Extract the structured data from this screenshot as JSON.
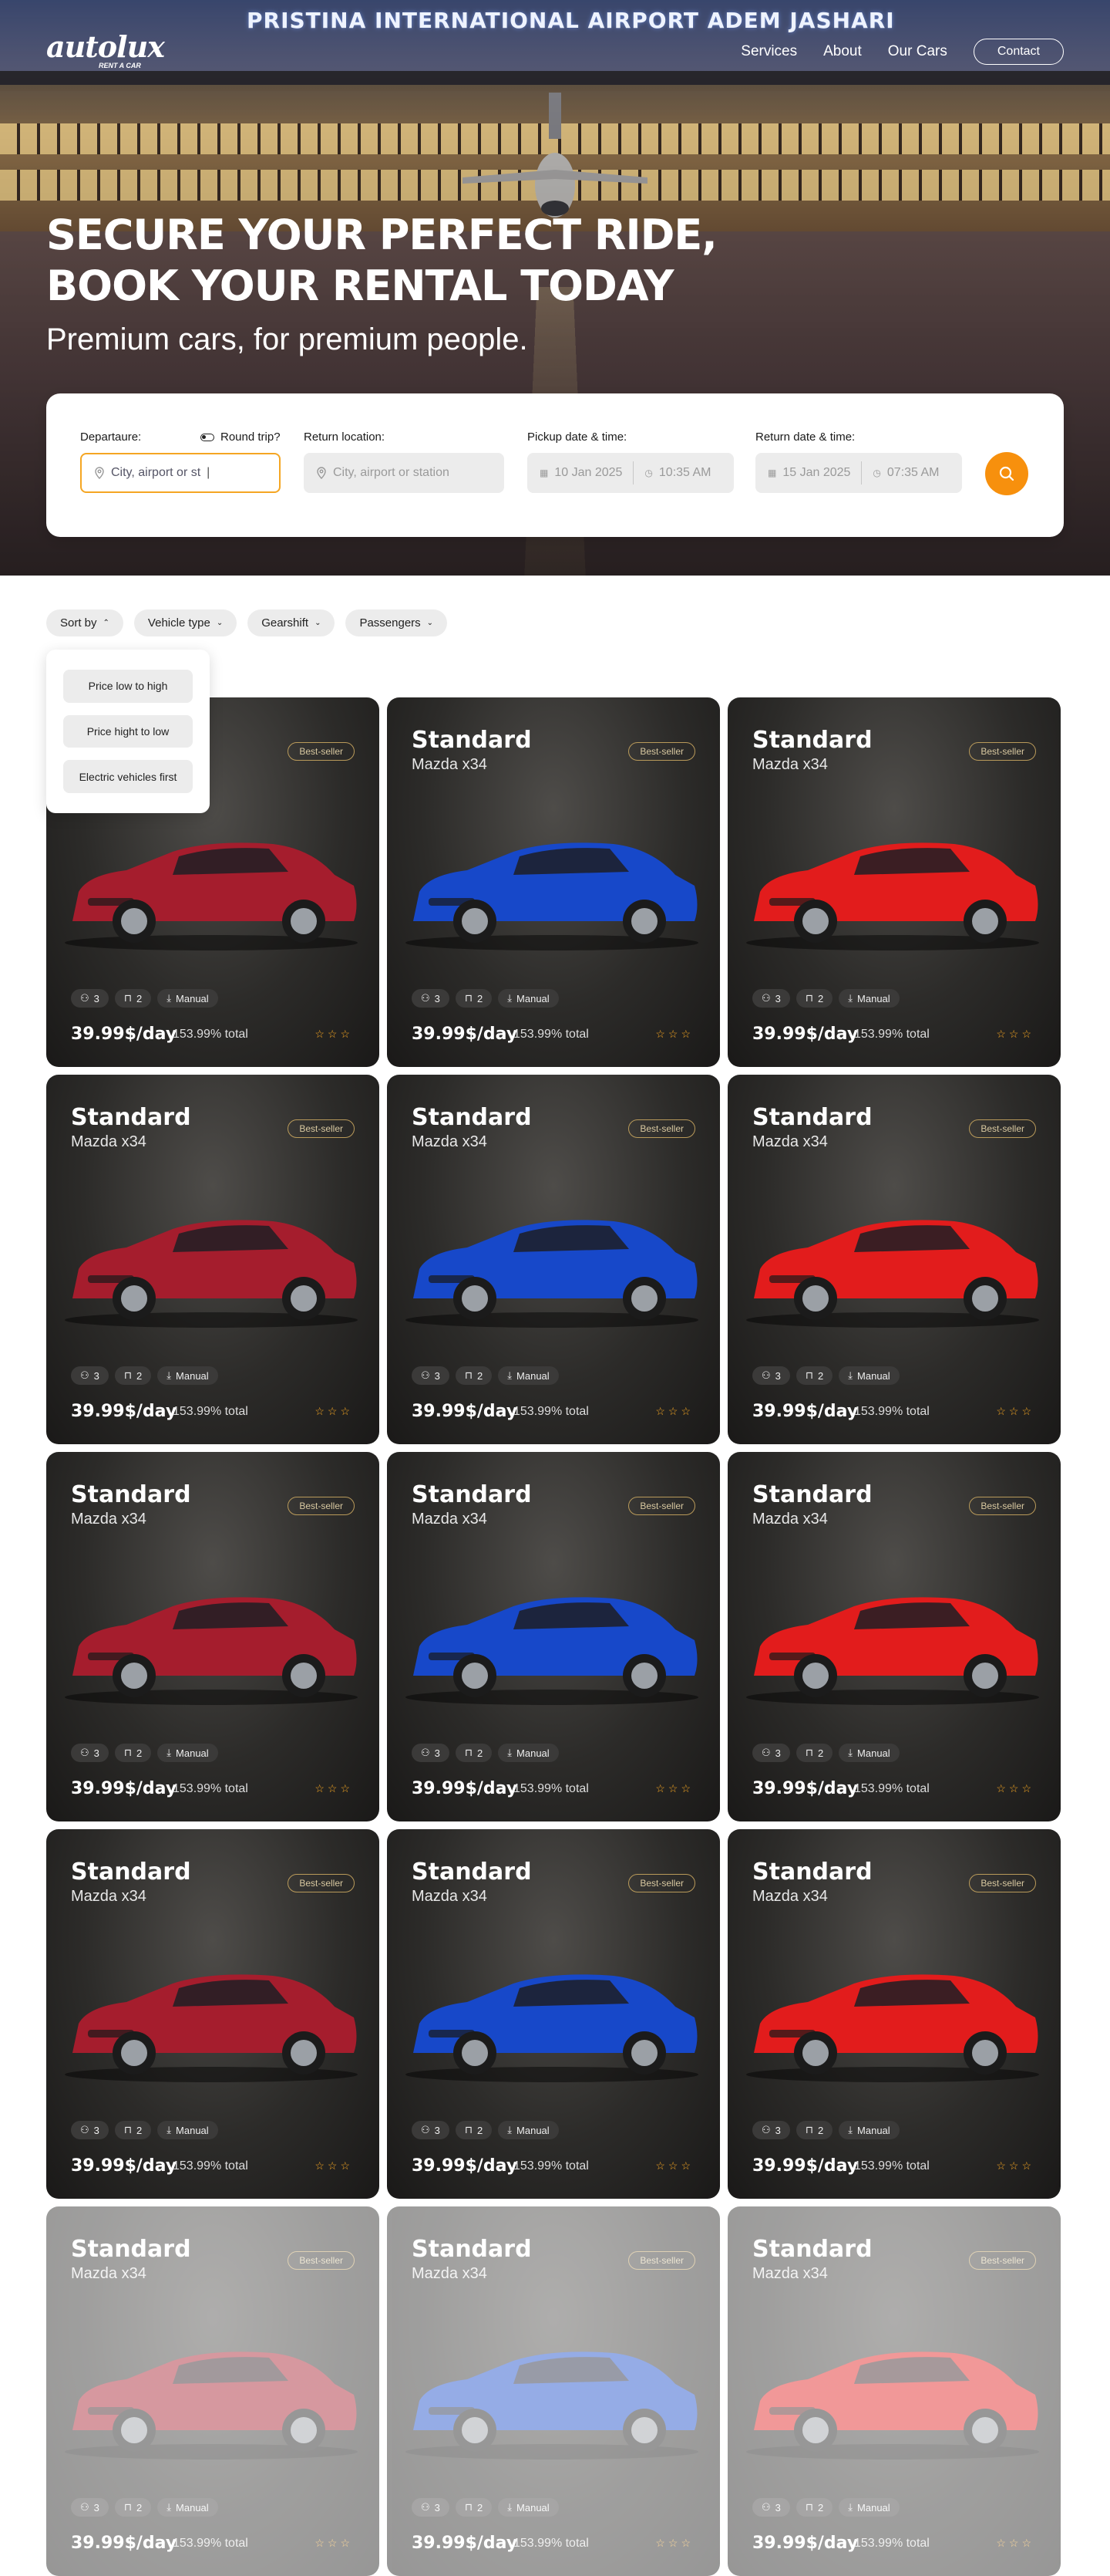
{
  "hero": {
    "sign": "PRISTINA INTERNATIONAL AIRPORT ADEM JASHARI",
    "logo": "autolux",
    "logo_tag": "RENT A CAR",
    "nav": [
      "Services",
      "About",
      "Our Cars"
    ],
    "contact": "Contact",
    "headline_1": "SECURE YOUR PERFECT RIDE,",
    "headline_2": "BOOK YOUR RENTAL TODAY",
    "subheadline": "Premium cars, for premium people."
  },
  "search": {
    "departure_label": "Departaure:",
    "departure_value": "City, airport or st",
    "round_trip": "Round trip?",
    "return_label": "Return location:",
    "return_placeholder": "City, airport or station",
    "pickup_label": "Pickup date & time:",
    "pickup_date": "10 Jan 2025",
    "pickup_time": "10:35 AM",
    "returndt_label": "Return date & time:",
    "return_date": "15 Jan 2025",
    "return_time": "07:35 AM"
  },
  "filters": [
    "Sort by",
    "Vehicle type",
    "Gearshift",
    "Passengers"
  ],
  "sort_options": [
    "Price low to high",
    "Price hight to low",
    "Electric vehicles first"
  ],
  "card": {
    "title": "Standard",
    "model": "Mazda x34",
    "badge": "Best-seller",
    "passengers": "3",
    "bags": "2",
    "gear": "Manual",
    "price": "39.99$/day",
    "total": "153.99% total",
    "stars": "☆☆☆"
  },
  "car_colors": [
    "#a51d2d",
    "#1748c9",
    "#e21c1c"
  ]
}
